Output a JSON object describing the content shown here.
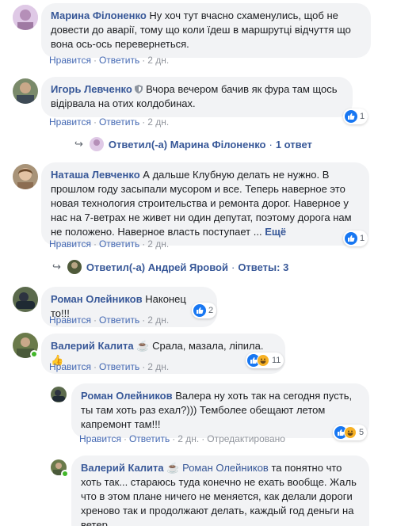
{
  "actions": {
    "like": "Нравится",
    "reply": "Ответить",
    "sep": "·",
    "edited": "Отредактировано"
  },
  "comments": [
    {
      "author": "Марина Філоненко",
      "text": "Ну хоч тут вчасно схаменулись, щоб не довести до аварії, тому що коли їдеш в маршрутці відчуття що вона ось-ось перевернеться.",
      "time": "2 дн."
    },
    {
      "author": "Игорь Левченко",
      "text": "Вчора вечером бачив як фура там щось відірвала на отих колдобинах.",
      "time": "2 дн.",
      "reactions": "1",
      "reply_summary": {
        "label": "Ответил(-а) Марина Філоненко",
        "count": "1 ответ"
      }
    },
    {
      "author": "Наташа Левченко",
      "text": "А дальше Клубную делать не нужно. В прошлом году засыпали мусором и все. Теперь наверное это новая технология строительства и ремонта дорог. Наверное у нас на 7-ветрах не живет ни один депутат, поэтому дорога нам не положено. Наверное власть поступает ...",
      "more": "Ещё",
      "time": "2 дн.",
      "reactions": "1",
      "reply_summary": {
        "label": "Ответил(-а) Андрей Яровой",
        "count": "Ответы: 3"
      }
    },
    {
      "author": "Роман Олейников",
      "text": "Наконец то!!!",
      "time": "2 дн.",
      "reactions": "2"
    },
    {
      "author": "Валерий Калита",
      "cup": "☕",
      "text": "Срала, мазала, ліпила.",
      "emoji": "👍",
      "time": "2 дн.",
      "reactions": "11"
    }
  ],
  "replies": [
    {
      "author": "Роман Олейников",
      "text": "Валера ну хоть так на сегодня пусть, ты там хоть раз ехал?))) Темболее обещают летом капремонт там!!!",
      "time": "2 дн.",
      "reactions": "5"
    },
    {
      "author": "Валерий Калита",
      "cup": "☕",
      "mention": "Роман Олейников",
      "text": "та понятно что хоть так... стараюсь туда конечно не ехать вообще. Жаль что в этом плане ничего не меняется, как делали дороги хреново так и продолжают делать, каждый год деньги на ветер.."
    }
  ]
}
